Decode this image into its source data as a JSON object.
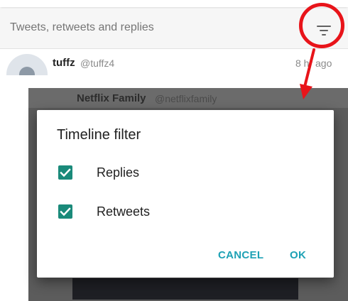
{
  "filter_bar": {
    "label": "Tweets, retweets and replies",
    "icon": "filter-icon"
  },
  "tweet": {
    "name": "tuffz",
    "handle": "@tuffz4",
    "time": "8 hr ago"
  },
  "background_tweet": {
    "name": "Netflix Family",
    "handle": "@netflixfamily"
  },
  "dialog": {
    "title": "Timeline filter",
    "options": [
      {
        "label": "Replies",
        "checked": true
      },
      {
        "label": "Retweets",
        "checked": true
      }
    ],
    "cancel_label": "CANCEL",
    "ok_label": "OK"
  },
  "colors": {
    "accent": "#1a8a7a",
    "button_text": "#1da1b5",
    "annotation": "#e8141a"
  }
}
